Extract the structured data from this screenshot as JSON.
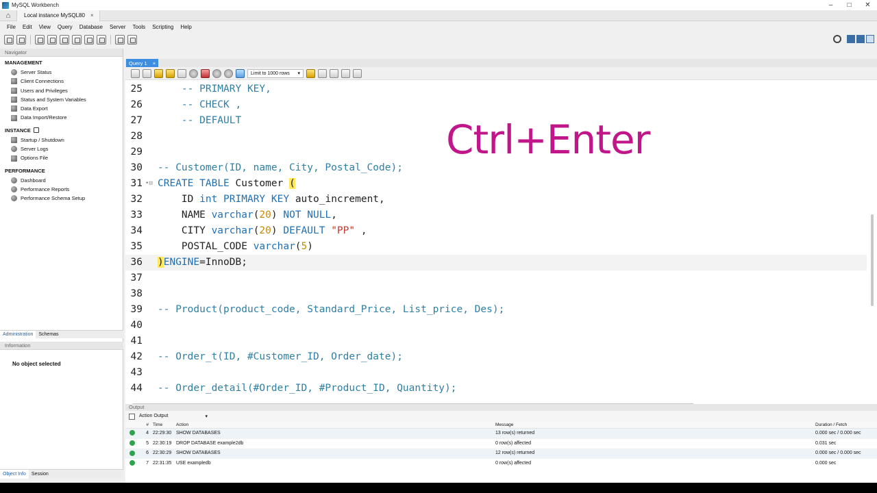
{
  "window": {
    "title": "MySQL Workbench",
    "controls": [
      "–",
      "□",
      "✕"
    ]
  },
  "connection_tab": {
    "label": "Local instance MySQL80",
    "close": "×"
  },
  "menu": [
    "File",
    "Edit",
    "View",
    "Query",
    "Database",
    "Server",
    "Tools",
    "Scripting",
    "Help"
  ],
  "navigator": {
    "header": "Navigator",
    "management": {
      "title": "MANAGEMENT",
      "items": [
        "Server Status",
        "Client Connections",
        "Users and Privileges",
        "Status and System Variables",
        "Data Export",
        "Data Import/Restore"
      ]
    },
    "instance": {
      "title": "INSTANCE",
      "items": [
        "Startup / Shutdown",
        "Server Logs",
        "Options File"
      ]
    },
    "performance": {
      "title": "PERFORMANCE",
      "items": [
        "Dashboard",
        "Performance Reports",
        "Performance Schema Setup"
      ]
    },
    "tabs": [
      "Administration",
      "Schemas"
    ]
  },
  "information": {
    "header": "Information",
    "empty_text": "No object selected",
    "tabs": [
      "Object Info",
      "Session"
    ]
  },
  "query_tab": {
    "label": "Query 1",
    "close": "×"
  },
  "editor_toolbar": {
    "limit_label": "Limit to 1000 rows"
  },
  "overlay": "Ctrl+Enter",
  "code_lines": [
    {
      "n": "25",
      "text": "    -- PRIMARY KEY,"
    },
    {
      "n": "26",
      "text": "    -- CHECK ,"
    },
    {
      "n": "27",
      "text": "    -- DEFAULT"
    },
    {
      "n": "28",
      "text": ""
    },
    {
      "n": "29",
      "text": ""
    },
    {
      "n": "30",
      "text": "-- Customer(ID, name, City, Postal_Code);"
    },
    {
      "n": "31",
      "text": "CREATE TABLE Customer ("
    },
    {
      "n": "32",
      "text": "    ID int PRIMARY KEY auto_increment,"
    },
    {
      "n": "33",
      "text": "    NAME varchar(20) NOT NULL,"
    },
    {
      "n": "34",
      "text": "    CITY varchar(20) DEFAULT \"PP\" ,"
    },
    {
      "n": "35",
      "text": "    POSTAL_CODE varchar(5)"
    },
    {
      "n": "36",
      "text": ")ENGINE=InnoDB;"
    },
    {
      "n": "37",
      "text": ""
    },
    {
      "n": "38",
      "text": ""
    },
    {
      "n": "39",
      "text": "-- Product(product_code, Standard_Price, List_price, Des);"
    },
    {
      "n": "40",
      "text": ""
    },
    {
      "n": "41",
      "text": ""
    },
    {
      "n": "42",
      "text": "-- Order_t(ID, #Customer_ID, Order_date);"
    },
    {
      "n": "43",
      "text": ""
    },
    {
      "n": "44",
      "text": "-- Order_detail(#Order_ID, #Product_ID, Quantity);"
    }
  ],
  "output": {
    "header": "Output",
    "selector": "Action Output",
    "columns": [
      "",
      "#",
      "Time",
      "Action",
      "Message",
      "Duration / Fetch"
    ],
    "rows": [
      {
        "num": "4",
        "time": "22:29:30",
        "action": "SHOW DATABASES",
        "message": "13 row(s) returned",
        "duration": "0.000 sec / 0.000 sec"
      },
      {
        "num": "5",
        "time": "22:30:19",
        "action": "DROP DATABASE example2db",
        "message": "0 row(s) affected",
        "duration": "0.031 sec"
      },
      {
        "num": "6",
        "time": "22:30:29",
        "action": "SHOW DATABASES",
        "message": "12 row(s) returned",
        "duration": "0.000 sec / 0.000 sec"
      },
      {
        "num": "7",
        "time": "22:31:35",
        "action": "USE exampledb",
        "message": "0 row(s) affected",
        "duration": "0.000 sec"
      }
    ],
    "status_color": "#2ea44f"
  },
  "colors": {
    "accent": "#3d8ee0",
    "overlay": "#c0168a",
    "comment": "#2f7fa3",
    "keyword": "#1f6fb5"
  }
}
